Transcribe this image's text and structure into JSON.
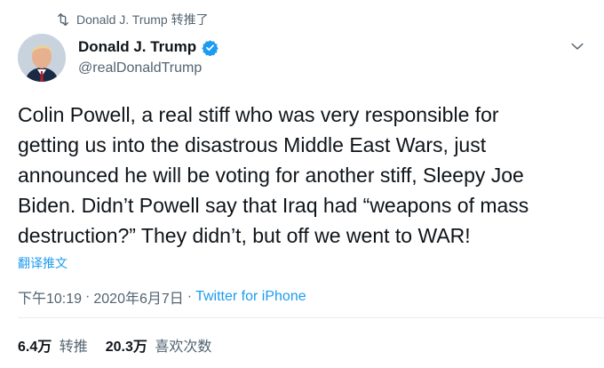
{
  "retweet": {
    "text": "Donald J. Trump 转推了"
  },
  "author": {
    "display_name": "Donald J. Trump",
    "handle": "@realDonaldTrump",
    "verified": true
  },
  "tweet": {
    "lines": [
      "Colin Powell, a real stiff who was very responsible for",
      "getting us into the disastrous Middle East Wars, just",
      "announced he will be voting for another stiff, Sleepy Joe",
      "Biden. Didn’t Powell say that Iraq had “weapons of mass",
      "destruction?” They didn’t, but off we went to WAR!"
    ],
    "translate_label": "翻译推文"
  },
  "meta": {
    "time": "下午10:19",
    "separator": "·",
    "date": "2020年6月7日",
    "source": "Twitter for iPhone"
  },
  "stats": {
    "retweets_count": "6.4万",
    "retweets_label": "转推",
    "likes_count": "20.3万",
    "likes_label": "喜欢次数"
  },
  "colors": {
    "accent": "#1d9bf0",
    "muted": "#536471"
  },
  "icons": {
    "retweet": "retweet-icon",
    "verified": "verified-badge-icon",
    "caret": "chevron-down-icon"
  }
}
